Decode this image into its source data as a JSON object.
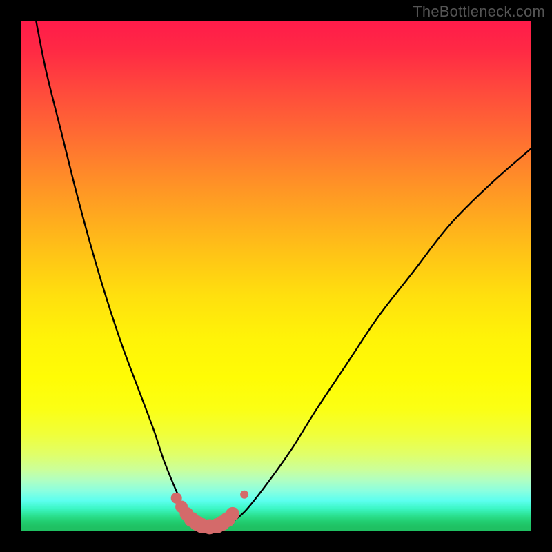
{
  "watermark": "TheBottleneck.com",
  "colors": {
    "background": "#000000",
    "curve_stroke": "#000000",
    "marker_fill": "#d46a6a",
    "marker_stroke": "#c05a5a"
  },
  "chart_data": {
    "type": "line",
    "title": "",
    "xlabel": "",
    "ylabel": "",
    "xlim": [
      0,
      100
    ],
    "ylim": [
      0,
      100
    ],
    "grid": false,
    "notes": "Bottleneck-style curve. Y is bottleneck percentage (0% at valley). Left and right branches converge to a flat trough (~0%) around x≈34–41. Decorative markers highlight the trough. Axes and numeric ticks are intentionally not drawn.",
    "series": [
      {
        "name": "left-branch",
        "x": [
          3,
          5,
          8,
          11,
          14,
          17,
          20,
          23,
          26,
          28,
          30,
          32,
          33.5
        ],
        "values": [
          100,
          90,
          78,
          66,
          55,
          45,
          36,
          28,
          20,
          14,
          9,
          4.5,
          1.5
        ]
      },
      {
        "name": "trough",
        "x": [
          33.5,
          35,
          37,
          39,
          41
        ],
        "values": [
          1.5,
          0.7,
          0.5,
          0.7,
          1.5
        ]
      },
      {
        "name": "right-branch",
        "x": [
          41,
          44,
          48,
          53,
          58,
          64,
          70,
          77,
          84,
          92,
          100
        ],
        "values": [
          1.5,
          4,
          9,
          16,
          24,
          33,
          42,
          51,
          60,
          68,
          75
        ]
      }
    ],
    "markers": {
      "name": "trough-highlight",
      "x": [
        30.5,
        31.5,
        32.5,
        33.5,
        34.5,
        35.5,
        37,
        38.5,
        39.5,
        40.5,
        41.5,
        43.8
      ],
      "values": [
        6.5,
        4.8,
        3.4,
        2.3,
        1.6,
        1.1,
        0.9,
        1.1,
        1.6,
        2.3,
        3.4,
        7.2
      ],
      "size": [
        8,
        9,
        10,
        11,
        11,
        11,
        11,
        11,
        11,
        11,
        10,
        6
      ]
    }
  }
}
